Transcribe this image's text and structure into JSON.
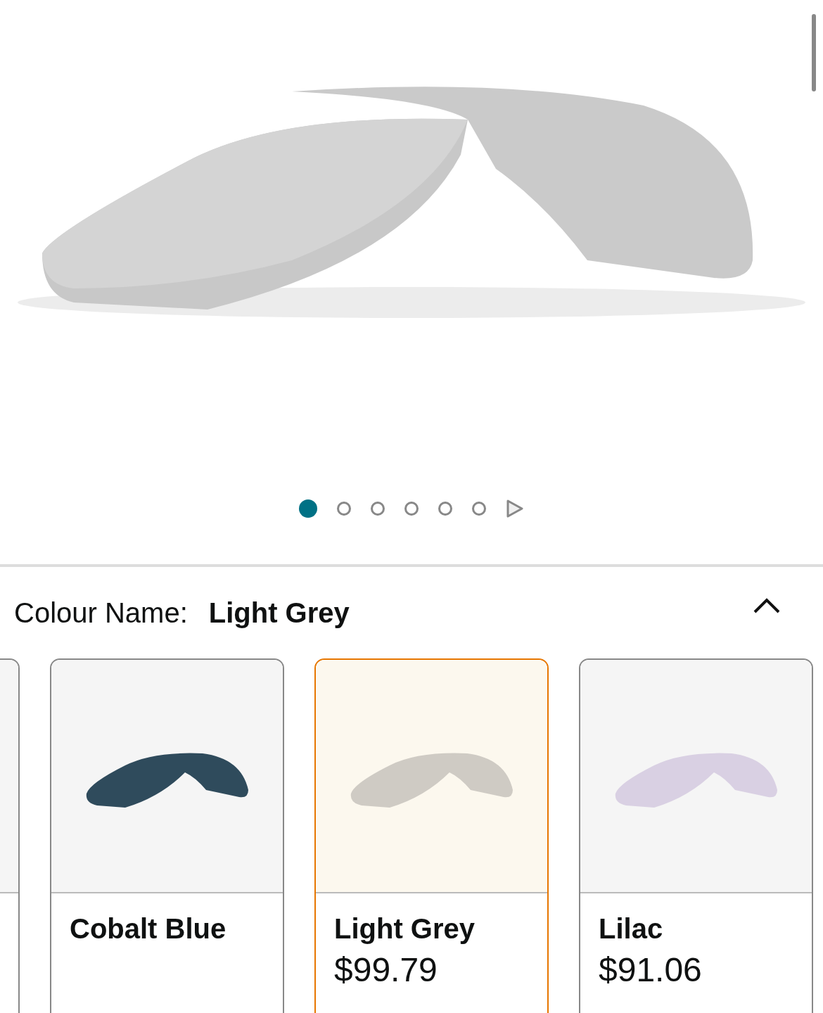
{
  "gallery": {
    "dots": [
      {
        "selected": true
      },
      {
        "selected": false
      },
      {
        "selected": false
      },
      {
        "selected": false
      },
      {
        "selected": false
      },
      {
        "selected": false
      }
    ]
  },
  "colour": {
    "label": "Colour Name:",
    "value": "Light Grey",
    "expanded": true
  },
  "swatches": [
    {
      "name": "Cobalt Blue",
      "color": "#2f4b5c",
      "selected": false
    },
    {
      "name": "Light Grey",
      "price": "$99.79",
      "color": "#cfcbc4",
      "selected": true
    },
    {
      "name": "Lilac",
      "price": "$91.06",
      "color": "#d9d0e3",
      "selected": false
    }
  ]
}
